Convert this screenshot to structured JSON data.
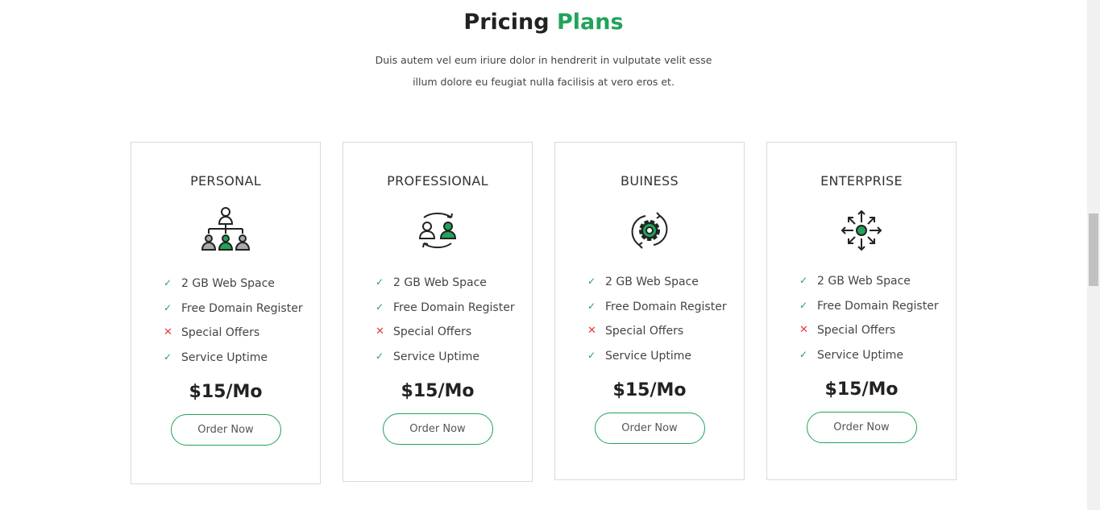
{
  "header": {
    "title_a": "Pricing",
    "title_b": "Plans",
    "subtitle_1": "Duis autem vel eum iriure dolor in hendrerit in vulputate velit esse",
    "subtitle_2": "illum dolore eu feugiat nulla facilisis at vero eros et."
  },
  "colors": {
    "accent": "#21a35a",
    "cross": "#e53935"
  },
  "plans": [
    {
      "name": "PERSONAL",
      "icon": "hierarchy-people-icon",
      "price": "$15/Mo",
      "button": "Order Now",
      "features": [
        {
          "label": "2 GB Web Space",
          "included": true
        },
        {
          "label": "Free Domain Register",
          "included": true
        },
        {
          "label": "Special Offers",
          "included": false
        },
        {
          "label": "Service Uptime",
          "included": true
        }
      ]
    },
    {
      "name": "PROFESSIONAL",
      "icon": "user-exchange-icon",
      "price": "$15/Mo",
      "button": "Order Now",
      "features": [
        {
          "label": "2 GB Web Space",
          "included": true
        },
        {
          "label": "Free Domain Register",
          "included": true
        },
        {
          "label": "Special Offers",
          "included": false
        },
        {
          "label": "Service Uptime",
          "included": true
        }
      ]
    },
    {
      "name": "BUINESS",
      "icon": "gear-refresh-icon",
      "price": "$15/Mo",
      "button": "Order Now",
      "features": [
        {
          "label": "2 GB Web Space",
          "included": true
        },
        {
          "label": "Free Domain Register",
          "included": true
        },
        {
          "label": "Special Offers",
          "included": false
        },
        {
          "label": "Service Uptime",
          "included": true
        }
      ]
    },
    {
      "name": "ENTERPRISE",
      "icon": "expand-arrows-icon",
      "price": "$15/Mo",
      "button": "Order Now",
      "features": [
        {
          "label": "2 GB Web Space",
          "included": true
        },
        {
          "label": "Free Domain Register",
          "included": true
        },
        {
          "label": "Special Offers",
          "included": false
        },
        {
          "label": "Service Uptime",
          "included": true
        }
      ]
    }
  ]
}
